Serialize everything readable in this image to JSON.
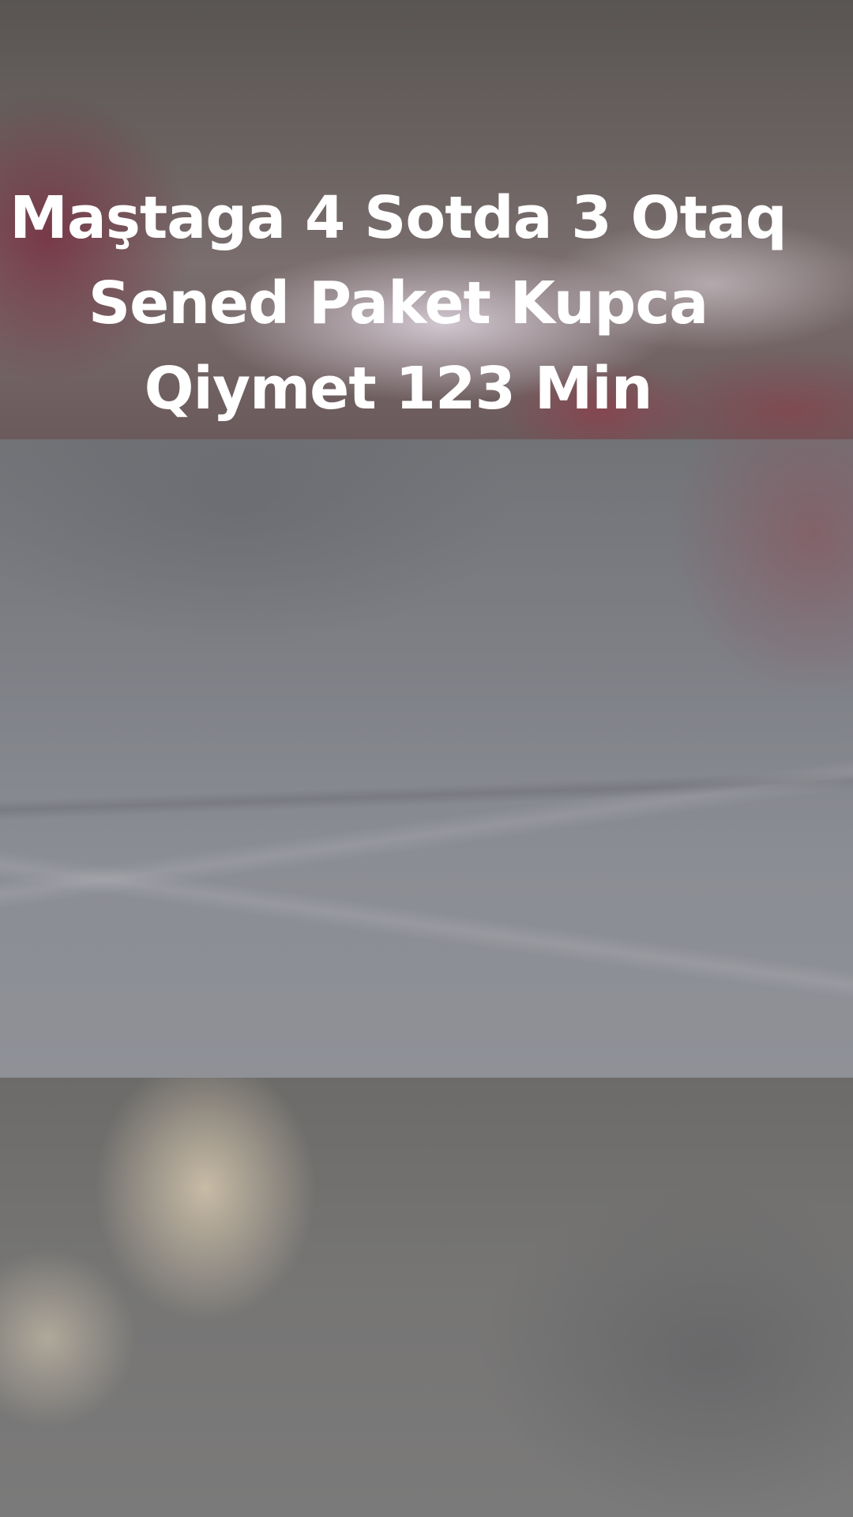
{
  "caption": {
    "line1": "Maştaga 4 Sotda 3 Otaq",
    "line2": "Sened Paket Kupca",
    "line3": "Qiymet 123 Min"
  }
}
